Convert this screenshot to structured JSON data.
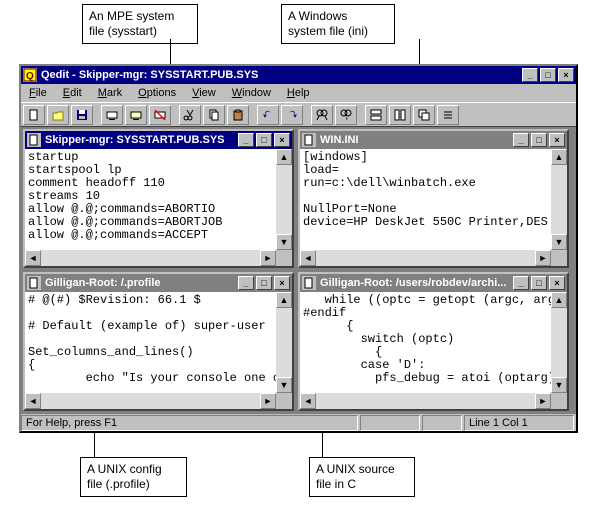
{
  "callouts": {
    "top_left": "An MPE system\nfile (sysstart)",
    "top_right": "A Windows\nsystem file (ini)",
    "bottom_left": "A UNIX config\nfile (.profile)",
    "bottom_right": "A UNIX source\nfile in C"
  },
  "app": {
    "title": "Qedit - Skipper-mgr: SYSSTART.PUB.SYS",
    "sys_icon": "qedit-icon"
  },
  "menus": {
    "file": "File",
    "edit": "Edit",
    "mark": "Mark",
    "options": "Options",
    "view": "View",
    "window": "Window",
    "help": "Help"
  },
  "toolbar_icons": [
    "new-doc-icon",
    "open-icon",
    "save-icon",
    "|",
    "connect1-icon",
    "connect2-icon",
    "disconnect-icon",
    "|",
    "cut-icon",
    "copy-icon",
    "paste-icon",
    "|",
    "undo-icon",
    "redo-icon",
    "|",
    "find-icon",
    "find-next-icon",
    "|",
    "tile-h-icon",
    "tile-v-icon",
    "cascade-icon",
    "list-icon"
  ],
  "statusbar": {
    "help": "For Help, press F1",
    "pos": "Line 1 Col 1"
  },
  "children": {
    "mpe": {
      "title": "Skipper-mgr: SYSSTART.PUB.SYS",
      "active": true,
      "content": "startup\nstartspool lp\ncomment headoff 110\nstreams 10\nallow @.@;commands=ABORTIO\nallow @.@;commands=ABORTJOB\nallow @.@;commands=ACCEPT"
    },
    "win_ini": {
      "title": "WIN.INI",
      "active": false,
      "content": "[windows]\nload=\nrun=c:\\dell\\winbatch.exe\n\nNullPort=None\ndevice=HP DeskJet 550C Printer,DES"
    },
    "profile": {
      "title": "Gilligan-Root: /.profile",
      "active": false,
      "content": "# @(#) $Revision: 66.1 $\n\n# Default (example of) super-user\n\nSet_columns_and_lines()\n{\n        echo \"Is your console one o"
    },
    "csrc": {
      "title": "Gilligan-Root: /users/robdev/archi...",
      "active": false,
      "content": "   while ((optc = getopt (argc, arg\n#endif\n      {\n        switch (optc)\n          {\n        case 'D':\n          pfs_debug = atoi (optarg);"
    }
  }
}
